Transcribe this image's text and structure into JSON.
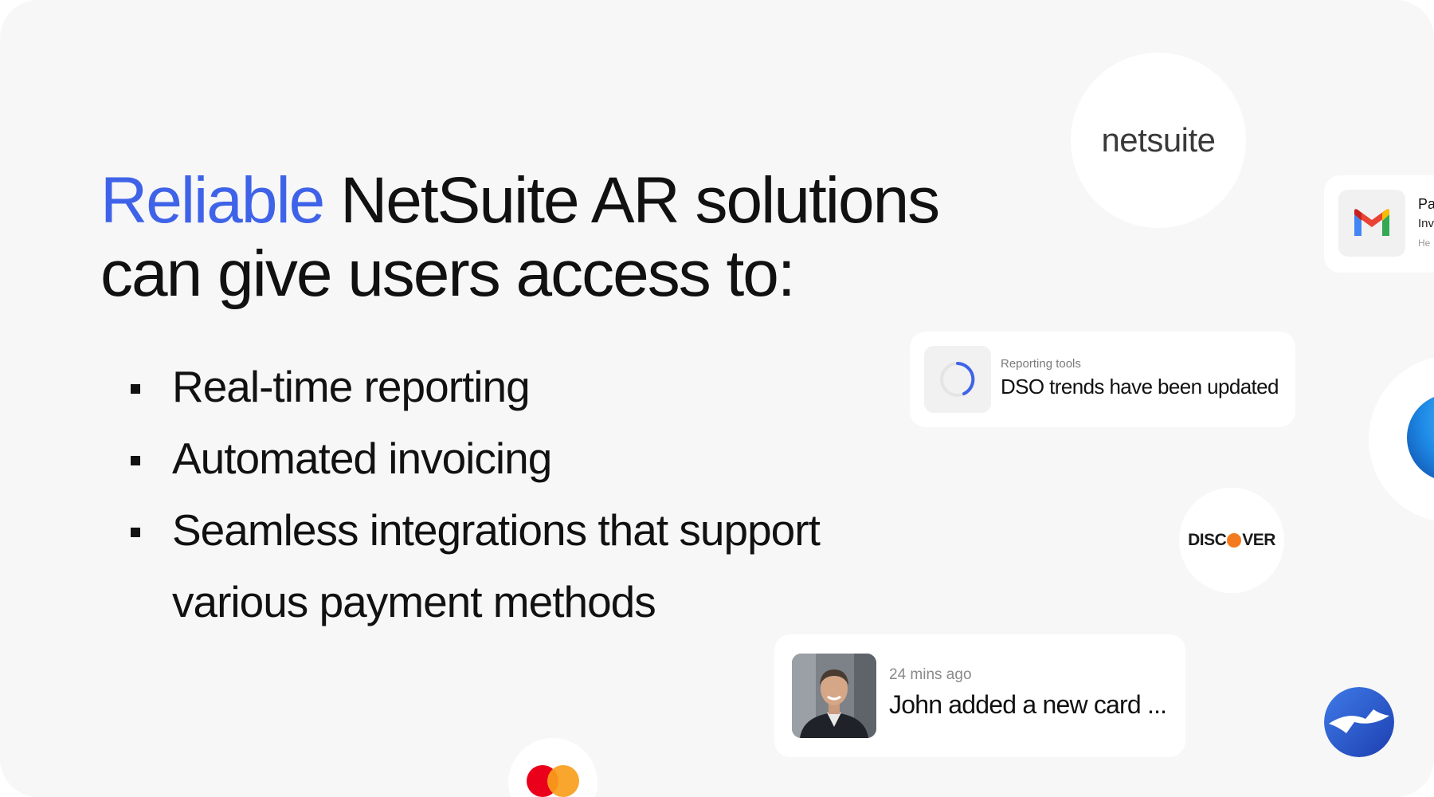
{
  "headline": {
    "accent": "Reliable",
    "line1_rest": " NetSuite AR solutions",
    "line2": "can give users access to:"
  },
  "bullets": [
    "Real-time reporting",
    "Automated invoicing",
    "Seamless integrations that support various payment methods"
  ],
  "netsuite_logo": "netsuite",
  "report_card": {
    "caption": "Reporting tools",
    "title": "DSO trends have been updated"
  },
  "gmail_card": {
    "line1": "Pa",
    "line2": "Inv",
    "line3": "He"
  },
  "discover_logo": {
    "left": "DISC",
    "right": "VER"
  },
  "activity_card": {
    "time": "24 mins ago",
    "message": "John added a new card ..."
  },
  "colors": {
    "accent": "#3f63e8",
    "background": "#f7f7f7",
    "discover_orange": "#f47a20",
    "mastercard_red": "#eb001b",
    "mastercard_orange": "#f79e1b"
  },
  "icons": [
    "gmail-icon",
    "loading-spinner-icon",
    "discover-logo",
    "mastercard-icon",
    "edge-browser-icon",
    "brand-bolt-icon",
    "user-avatar"
  ]
}
